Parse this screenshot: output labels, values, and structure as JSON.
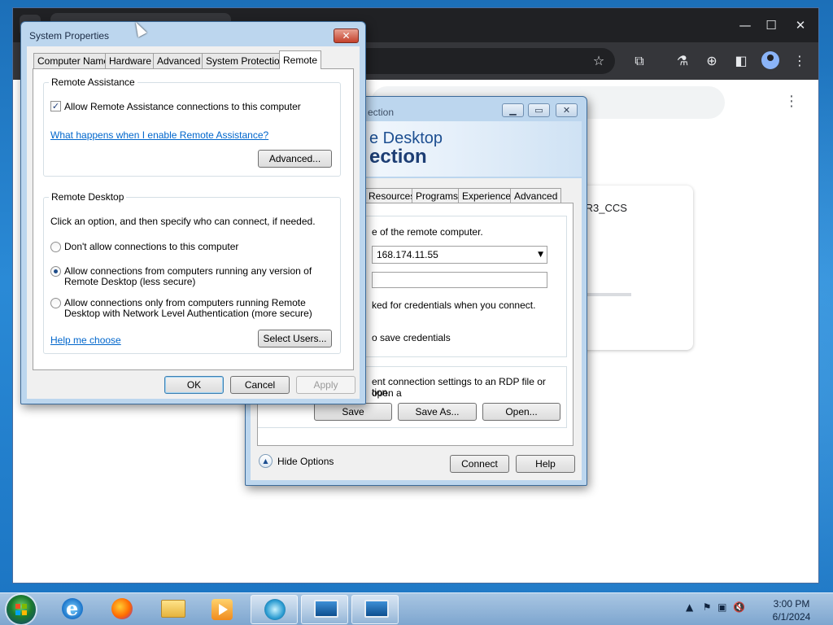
{
  "system_properties": {
    "title": "System Properties",
    "tabs": [
      "Computer Name",
      "Hardware",
      "Advanced",
      "System Protection",
      "Remote"
    ],
    "active_tab": "Remote",
    "remote_assistance": {
      "group_label": "Remote Assistance",
      "allow_checkbox_label": "Allow Remote Assistance connections to this computer",
      "allow_checked": true,
      "help_link": "What happens when I enable Remote Assistance?",
      "advanced_button": "Advanced..."
    },
    "remote_desktop": {
      "group_label": "Remote Desktop",
      "instruction": "Click an option, and then specify who can connect, if needed.",
      "option1": "Don't allow connections to this computer",
      "option2_line1": "Allow connections from computers running any version of",
      "option2_line2": "Remote Desktop (less secure)",
      "option3_line1": "Allow connections only from computers running Remote",
      "option3_line2": "Desktop with Network Level Authentication (more secure)",
      "selected_option": 2,
      "help_link": "Help me choose",
      "select_users_button": "Select Users..."
    },
    "buttons": {
      "ok": "OK",
      "cancel": "Cancel",
      "apply": "Apply"
    }
  },
  "rdc": {
    "title_fragment": "ection",
    "banner_line1": "e Desktop",
    "banner_line2": "ection",
    "tabs": [
      "Resources",
      "Programs",
      "Experience",
      "Advanced"
    ],
    "computer_label_fragment": "e of the remote computer.",
    "computer_value": "168.174.11.55",
    "credentials_fragment": "ked for credentials when you connect.",
    "save_credentials_fragment": "o save credentials",
    "settings_fragment_line1": "ent connection settings to an RDP file or open a",
    "settings_fragment_line2": "tion.",
    "save_button": "Save",
    "save_as_button": "Save As...",
    "open_button": "Open...",
    "hide_options": "Hide Options",
    "connect_button": "Connect",
    "help_button": "Help"
  },
  "chrome": {
    "card_label_fragment": "IR3_CCS"
  },
  "taskbar": {
    "apps": [
      "internet-explorer",
      "firefox",
      "file-explorer",
      "media-player",
      "remote-desktop-connection",
      "system-properties"
    ],
    "clock_time": "3:00 PM",
    "clock_date": "6/1/2024"
  },
  "colors": {
    "link": "#0066cc",
    "banner_text": "#1d4f91",
    "window_frame": "#bcd6ee",
    "taskbar": "#7ea6cf"
  }
}
